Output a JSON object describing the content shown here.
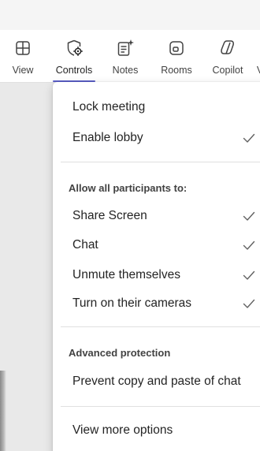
{
  "toolbar": {
    "items": [
      {
        "label": "View",
        "icon": "grid-icon"
      },
      {
        "label": "Controls",
        "icon": "shield-gear-icon"
      },
      {
        "label": "Notes",
        "icon": "notes-sparkle-icon"
      },
      {
        "label": "Rooms",
        "icon": "rooms-icon"
      },
      {
        "label": "Copilot",
        "icon": "copilot-icon"
      },
      {
        "label": "V",
        "icon": "cutoff-icon"
      }
    ],
    "active": "Controls",
    "accent": "#5b5fc7"
  },
  "menu": {
    "lock_meeting": "Lock meeting",
    "enable_lobby": {
      "label": "Enable lobby",
      "checked": true
    },
    "participants_header": "Allow all participants to:",
    "participants_options": [
      {
        "label": "Share Screen",
        "checked": true
      },
      {
        "label": "Chat",
        "checked": true
      },
      {
        "label": "Unmute themselves",
        "checked": true
      },
      {
        "label": "Turn on their cameras",
        "checked": true
      }
    ],
    "advanced_header": "Advanced protection",
    "prevent_copy": "Prevent copy and paste of chat",
    "view_more": "View more options"
  }
}
